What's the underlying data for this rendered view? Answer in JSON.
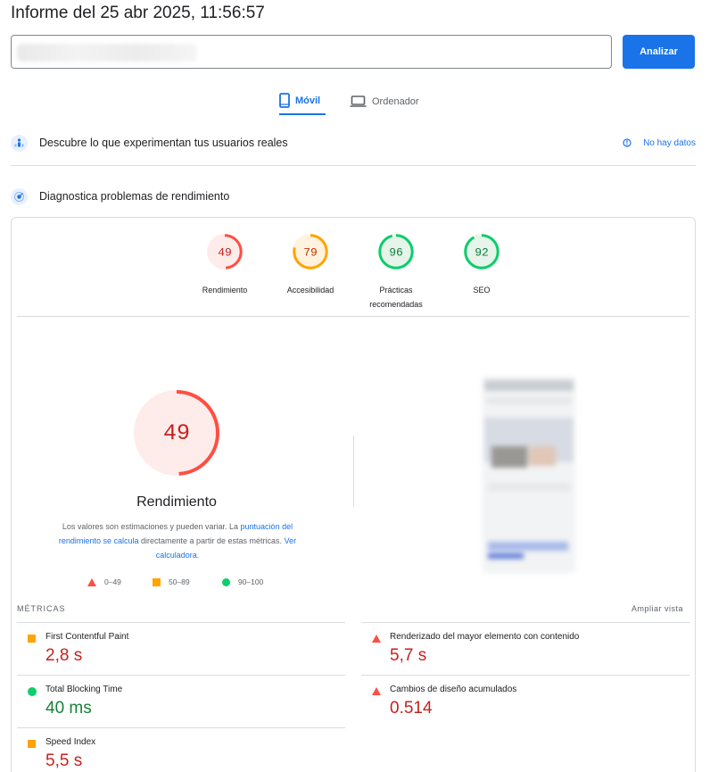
{
  "header": {
    "title": "Informe del 25 abr 2025, 11:56:57"
  },
  "search": {
    "button_label": "Analizar"
  },
  "tabs": [
    {
      "label": "Móvil",
      "active": true
    },
    {
      "label": "Ordenador",
      "active": false
    }
  ],
  "field_section": {
    "title": "Descubre lo que experimentan tus usuarios reales",
    "status": "No hay datos"
  },
  "lab_section": {
    "title": "Diagnostica problemas de rendimiento"
  },
  "categories": [
    {
      "score": "49",
      "label": "Rendimiento",
      "color": "#c5221f",
      "ring": "#ff4e42"
    },
    {
      "score": "79",
      "label": "Accesibilidad",
      "color": "#c33300",
      "ring": "#ffa400"
    },
    {
      "score": "96",
      "label": "Prácticas recomendadas",
      "color": "#0b8043",
      "ring": "#0cce6b"
    },
    {
      "score": "92",
      "label": "SEO",
      "color": "#0b8043",
      "ring": "#0cce6b"
    }
  ],
  "performance": {
    "score": "49",
    "title": "Rendimiento",
    "desc_1": "Los valores son estimaciones y pueden variar. La ",
    "desc_link_1": "puntuación del rendimiento se calcula",
    "desc_2": " directamente a partir de estas métricas. ",
    "desc_link_2": "Ver calculadora",
    "desc_3": "."
  },
  "legend": [
    {
      "range": "0–49",
      "shape": "triangle",
      "color": "#ff4e42"
    },
    {
      "range": "50–89",
      "shape": "square",
      "color": "#ffa400"
    },
    {
      "range": "90–100",
      "shape": "circle",
      "color": "#0cce6b"
    }
  ],
  "metrics": {
    "heading": "MÉTRICAS",
    "expand_label": "Ampliar vista",
    "items": [
      {
        "name": "First Contentful Paint",
        "value": "2,8 s",
        "rating": "average"
      },
      {
        "name": "Renderizado del mayor elemento con contenido",
        "value": "5,7 s",
        "rating": "poor"
      },
      {
        "name": "Total Blocking Time",
        "value": "40 ms",
        "rating": "good"
      },
      {
        "name": "Cambios de diseño acumulados",
        "value": "0.514",
        "rating": "poor"
      },
      {
        "name": "Speed Index",
        "value": "5,5 s",
        "rating": "average"
      }
    ]
  }
}
